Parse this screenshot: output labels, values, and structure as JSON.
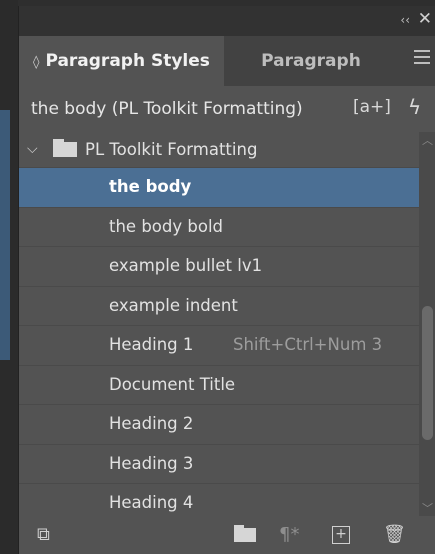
{
  "panel": {
    "collapse_glyph": "‹‹",
    "close_glyph": "✕"
  },
  "tabs": [
    {
      "label": "Paragraph Styles",
      "active": true
    },
    {
      "label": "Paragraph",
      "active": false
    }
  ],
  "style_row": {
    "current_style": "the body (PL Toolkit Formatting)",
    "new_override_glyph": "[a+]",
    "lightning_glyph": "ϟ"
  },
  "group": {
    "label": "PL Toolkit Formatting",
    "expanded_glyph": "⌵"
  },
  "styles": [
    {
      "label": "the body",
      "selected": true,
      "shortcut": ""
    },
    {
      "label": "the body bold",
      "selected": false,
      "shortcut": ""
    },
    {
      "label": "example bullet lv1",
      "selected": false,
      "shortcut": ""
    },
    {
      "label": "example indent",
      "selected": false,
      "shortcut": ""
    },
    {
      "label": "Heading 1",
      "selected": false,
      "shortcut": "Shift+Ctrl+Num 3"
    },
    {
      "label": "Document Title",
      "selected": false,
      "shortcut": ""
    },
    {
      "label": "Heading 2",
      "selected": false,
      "shortcut": ""
    },
    {
      "label": "Heading 3",
      "selected": false,
      "shortcut": ""
    },
    {
      "label": "Heading 4",
      "selected": false,
      "shortcut": ""
    }
  ],
  "footer": {
    "load_icon": "⧉",
    "clear_icon": "¶*",
    "new_icon": "+",
    "trash_icon": "🗑"
  },
  "colors": {
    "panel": "#535353",
    "selected": "#4b6f94",
    "titlebar": "#323232"
  }
}
